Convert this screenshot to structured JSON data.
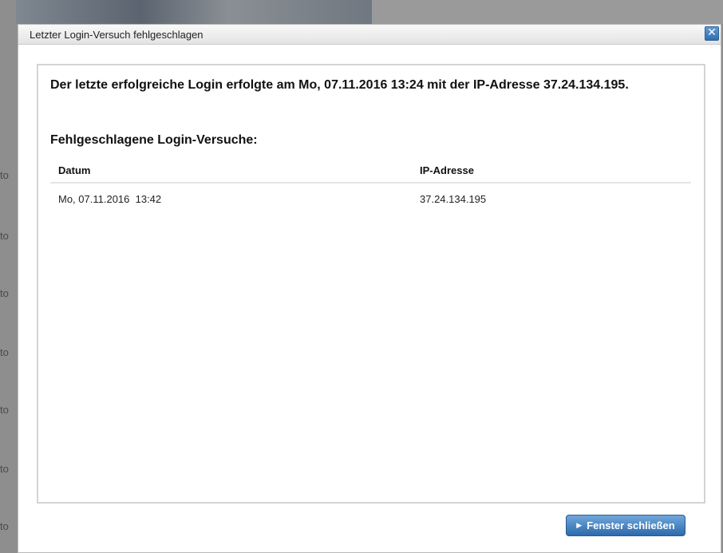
{
  "dialog": {
    "title": "Letzter Login-Versuch fehlgeschlagen",
    "close_icon": "close-icon",
    "last_login_text": "Der letzte erfolgreiche Login erfolgte am Mo, 07.11.2016 13:24 mit der IP-Adresse 37.24.134.195.",
    "failed_heading": "Fehlgeschlagene Login-Versuche:",
    "table": {
      "columns": [
        "Datum",
        "IP-Adresse"
      ],
      "rows": [
        {
          "date": "Mo, 07.11.2016  13:42",
          "ip": "37.24.134.195"
        }
      ]
    },
    "close_button_label": "Fenster schließen",
    "close_button_icon": "triangle-right-icon"
  },
  "background": {
    "fragments": [
      "to",
      "to",
      "to",
      "to",
      "to",
      "to",
      "to"
    ]
  }
}
